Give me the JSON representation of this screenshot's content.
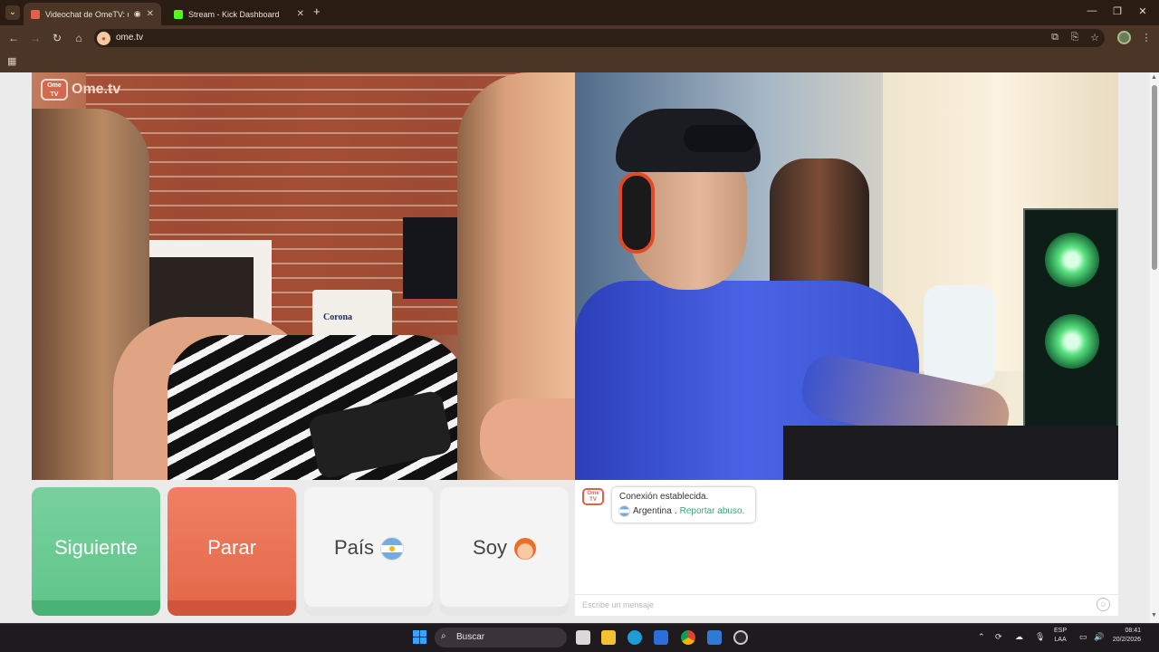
{
  "browser": {
    "tabs": [
      {
        "title": "Videochat de OmeTV: uno",
        "active": true,
        "favicon_color": "#e0604a"
      },
      {
        "title": "Stream - Kick Dashboard",
        "active": false,
        "favicon_color": "#53fc18"
      }
    ],
    "url": "ome.tv",
    "window_controls": [
      "minimize-icon",
      "restore-icon",
      "close-icon"
    ],
    "toolbar_icons": [
      "translate-icon",
      "install-icon",
      "star-icon",
      "menu-icon"
    ]
  },
  "page": {
    "logo": {
      "badge": "Ome TV",
      "text": "Ome.tv"
    },
    "controls": {
      "next": "Siguiente",
      "stop": "Parar",
      "country": "País",
      "soy": "Soy"
    },
    "chat": {
      "logo": "Ome TV",
      "status": "Conexión establecida.",
      "country": "Argentina",
      "separator": ".",
      "report": "Reportar abuso.",
      "placeholder": "Escribe un mensaje"
    },
    "colors": {
      "next": "#62c68c",
      "stop": "#e56a4c",
      "report": "#3aa777"
    }
  },
  "taskbar": {
    "search": "Buscar",
    "language": [
      "ESP",
      "LAA"
    ],
    "time": "08:41",
    "date": "20/2/2026"
  }
}
